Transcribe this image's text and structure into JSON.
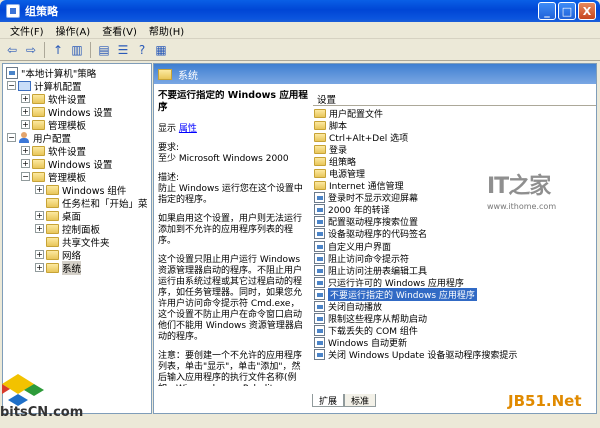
{
  "window": {
    "title": "组策略",
    "minimize_glyph": "_",
    "maximize_glyph": "□",
    "close_glyph": "X"
  },
  "menubar": {
    "items": [
      {
        "label": "文件(F)"
      },
      {
        "label": "操作(A)"
      },
      {
        "label": "查看(V)"
      },
      {
        "label": "帮助(H)"
      }
    ]
  },
  "toolbar": {
    "buttons": [
      {
        "name": "back-icon",
        "glyph": "⇦"
      },
      {
        "name": "forward-icon",
        "glyph": "⇨"
      },
      {
        "name": "up-folder-icon",
        "glyph": "↑"
      },
      {
        "name": "show-tree-icon",
        "glyph": "▥"
      },
      {
        "name": "export-icon",
        "glyph": "▤"
      },
      {
        "name": "properties-icon",
        "glyph": "☰"
      },
      {
        "name": "help-icon",
        "glyph": "?"
      },
      {
        "name": "extended-view-icon",
        "glyph": "▦"
      }
    ]
  },
  "tree": {
    "root": {
      "label": "\"本地计算机\"策略"
    },
    "computer_config": {
      "label": "计算机配置",
      "expander": "−",
      "children": [
        {
          "label": "软件设置",
          "expander": "+"
        },
        {
          "label": "Windows 设置",
          "expander": "+"
        },
        {
          "label": "管理模板",
          "expander": "+"
        }
      ]
    },
    "user_config": {
      "label": "用户配置",
      "expander": "−",
      "children": [
        {
          "label": "软件设置",
          "expander": "+"
        },
        {
          "label": "Windows 设置",
          "expander": "+"
        },
        {
          "label": "管理模板",
          "expander": "−"
        }
      ]
    },
    "admin_templates_children": [
      {
        "label": "Windows 组件",
        "expander": "+"
      },
      {
        "label": "任务栏和「开始」菜",
        "expander": ""
      },
      {
        "label": "桌面",
        "expander": "+"
      },
      {
        "label": "控制面板",
        "expander": "+"
      },
      {
        "label": "共享文件夹",
        "expander": ""
      },
      {
        "label": "网络",
        "expander": "+"
      },
      {
        "label": "系统",
        "expander": "+"
      }
    ],
    "selected": "系统"
  },
  "section": {
    "title": "系统"
  },
  "description": {
    "title": "不要运行指定的 Windows 应用程序",
    "show_label": "显示",
    "properties_link": "属性",
    "requirements_label": "要求:",
    "requirements_value": "至少 Microsoft Windows 2000",
    "describe_label": "描述:",
    "describe_value": "防止 Windows 运行您在这个设置中指定的程序。",
    "p1": "如果启用这个设置，用户则无法运行添加到不允许的应用程序列表的程序。",
    "p2": "这个设置只阻止用户运行 Windows 资源管理器启动的程序。不阻止用户运行由系统过程或其它过程启动的程序，如任务管理器。同时，如果您允许用户访问命令提示符 Cmd.exe，这个设置不防止用户在命令窗口启动他们不能用 Windows 资源管理器启动的程序。",
    "p3": "注意：要创建一个不允许的应用程序列表，单击\"显示\"，单击\"添加\"，然后输入应用程序的执行文件名称(例如，Winword.exe，Poledit.exe，Powerpnt.exe)。"
  },
  "settings_list": {
    "header": "设置",
    "folders": [
      "用户配置文件",
      "脚本",
      "Ctrl+Alt+Del 选项",
      "登录",
      "组策略",
      "电源管理",
      "Internet 通信管理"
    ],
    "policies": [
      "登录时不显示欢迎屏幕",
      "2000 年的转译",
      "配置驱动程序搜索位置",
      "设备驱动程序的代码签名",
      "自定义用户界面",
      "阻止访问命令提示符",
      "阻止访问注册表编辑工具",
      "只运行许可的 Windows 应用程序",
      "不要运行指定的 Windows 应用程序",
      "关闭自动播放",
      "限制这些程序从帮助启动",
      "下载丢失的 COM 组件",
      "Windows 自动更新",
      "关闭 Windows Update 设备驱动程序搜索提示"
    ],
    "selected": "不要运行指定的 Windows 应用程序"
  },
  "tabs": [
    {
      "label": "扩展",
      "active": true
    },
    {
      "label": "标准",
      "active": false
    }
  ],
  "watermarks": {
    "bits": "bitsCN.com",
    "ithome_logo": "IT之家",
    "ithome_url": "www.ithome.com",
    "jb51": "JB51.Net"
  }
}
